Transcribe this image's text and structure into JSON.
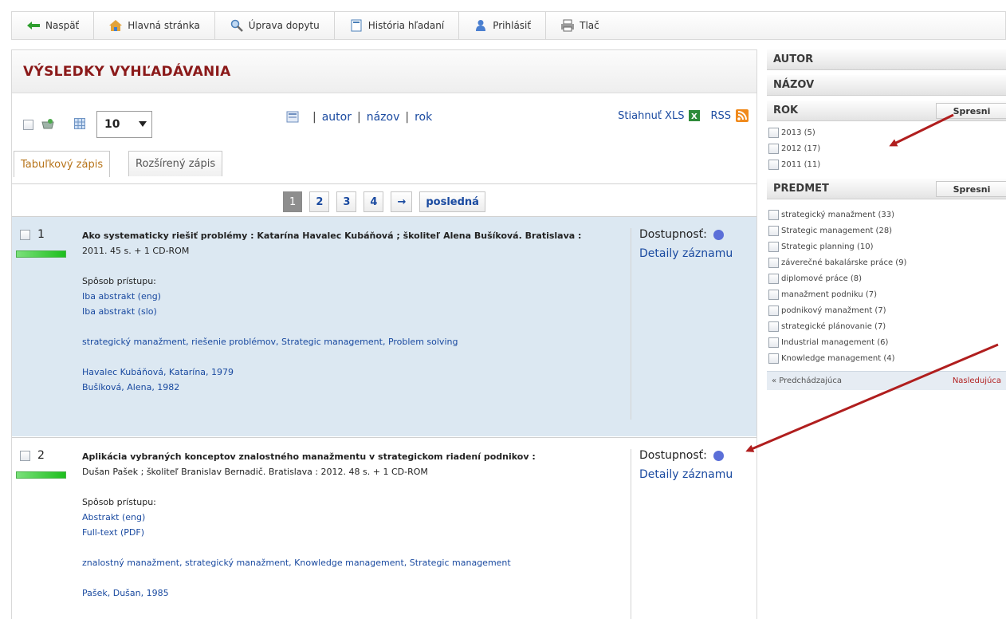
{
  "toolbar": {
    "back": "Naspäť",
    "home": "Hlavná stránka",
    "edit_query": "Úprava dopytu",
    "history": "História hľadaní",
    "login": "Prihlásiť",
    "print": "Tlač"
  },
  "results": {
    "title": "VÝSLEDKY VYHĽADÁVANIA",
    "per_page": "10",
    "sort": {
      "sep": "|",
      "author": "autor",
      "title": "názov",
      "year": "rok"
    },
    "export_xls": "Stiahnuť XLS",
    "rss": "RSS",
    "tabs": [
      "Tabuľkový zápis",
      "Rozšírený zápis"
    ],
    "pager": [
      "1",
      "2",
      "3",
      "4",
      "→",
      "posledná"
    ]
  },
  "records": [
    {
      "num": "1",
      "relevance": 1.0,
      "title_line": "Ako systematicky riešiť problémy : Katarína Havalec Kubáňová ; školiteľ Alena Bušíková. Bratislava :",
      "line2": "2011. 45 s. + 1 CD-ROM",
      "access_label": "Spôsob prístupu:",
      "access_links": [
        "Iba abstrakt (eng)",
        "Iba abstrakt (slo)"
      ],
      "subjects": "strategický manažment, riešenie problémov, Strategic management, Problem solving",
      "authors": [
        "Havalec Kubáňová, Katarína, 1979",
        "Bušíková, Alena, 1982"
      ],
      "availability": "Dostupnosť:",
      "details": "Detaily záznamu"
    },
    {
      "num": "2",
      "relevance": 1.0,
      "title_line": "Aplikácia vybraných konceptov znalostného manažmentu v strategickom riadení podnikov :",
      "line2": "Dušan Pašek ; školiteľ Branislav Bernadič. Bratislava : 2012. 48 s. + 1 CD-ROM",
      "access_label": "Spôsob prístupu:",
      "access_links": [
        "Abstrakt (eng)",
        "Full-text (PDF)"
      ],
      "subjects": "znalostný manažment, strategický manažment, Knowledge management, Strategic management",
      "authors": [
        "Pašek, Dušan, 1985"
      ],
      "availability": "Dostupnosť:",
      "details": "Detaily záznamu"
    }
  ],
  "facets": {
    "author": "AUTOR",
    "title": "NÁZOV",
    "year": "ROK",
    "subject": "PREDMET",
    "refine": "Spresni",
    "years": [
      "2013 (5)",
      "2012 (17)",
      "2011 (11)"
    ],
    "subjects": [
      "strategický manažment (33)",
      "Strategic management (28)",
      "Strategic planning (10)",
      "záverečné bakalárske práce (9)",
      "diplomové práce (8)",
      "manažment podniku (7)",
      "podnikový manažment (7)",
      "strategické plánovanie (7)",
      "Industrial management (6)",
      "Knowledge management (4)"
    ],
    "prev": "« Predchádzajúca",
    "next": "Nasledujúca"
  },
  "colors": {
    "title_red": "#8b1a1a",
    "link_blue": "#1a4aa0",
    "record_highlight": "#dce8f2",
    "annotation_arrow": "#b01e1e",
    "availability_dot": "#5b6fd8"
  }
}
